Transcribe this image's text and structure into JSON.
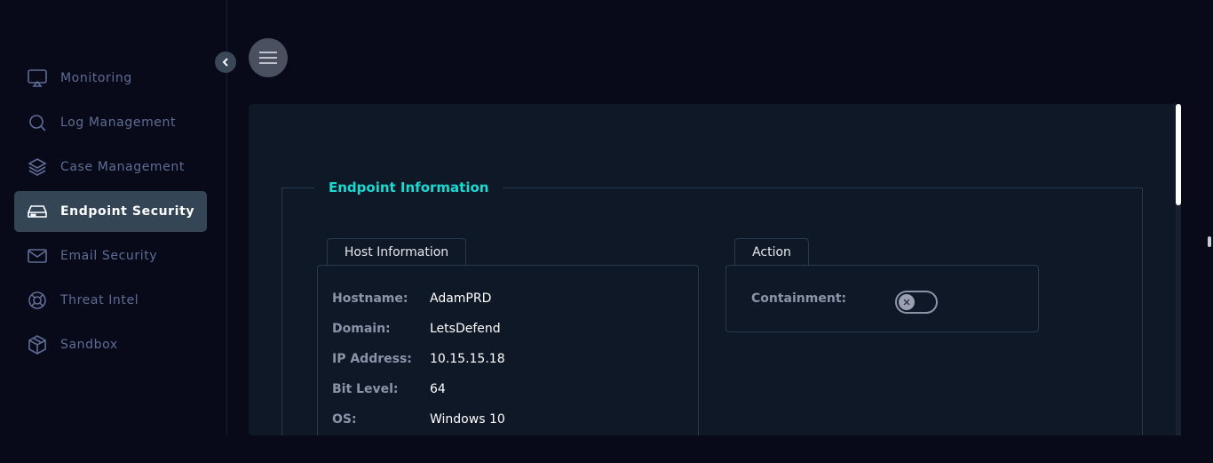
{
  "sidebar": {
    "items": [
      {
        "label": "Monitoring",
        "icon": "monitor-icon"
      },
      {
        "label": "Log Management",
        "icon": "search-icon"
      },
      {
        "label": "Case Management",
        "icon": "layers-icon"
      },
      {
        "label": "Endpoint Security",
        "icon": "hard-drive-icon",
        "active": true
      },
      {
        "label": "Email Security",
        "icon": "mail-icon"
      },
      {
        "label": "Threat Intel",
        "icon": "lifebuoy-icon"
      },
      {
        "label": "Sandbox",
        "icon": "cube-icon"
      }
    ]
  },
  "main": {
    "section_title": "Endpoint Information",
    "host_tab": "Host Information",
    "action_tab": "Action",
    "host": [
      {
        "key": "Hostname:",
        "value": "AdamPRD"
      },
      {
        "key": "Domain:",
        "value": "LetsDefend"
      },
      {
        "key": "IP Address:",
        "value": "10.15.15.18"
      },
      {
        "key": "Bit Level:",
        "value": "64"
      },
      {
        "key": "OS:",
        "value": "Windows 10"
      }
    ],
    "action": {
      "containment_label": "Containment:",
      "containment_enabled": false
    }
  },
  "colors": {
    "accent": "#19d9d0",
    "active_nav_bg": "#344656",
    "background": "#080a19",
    "panel": "#0f1826"
  }
}
